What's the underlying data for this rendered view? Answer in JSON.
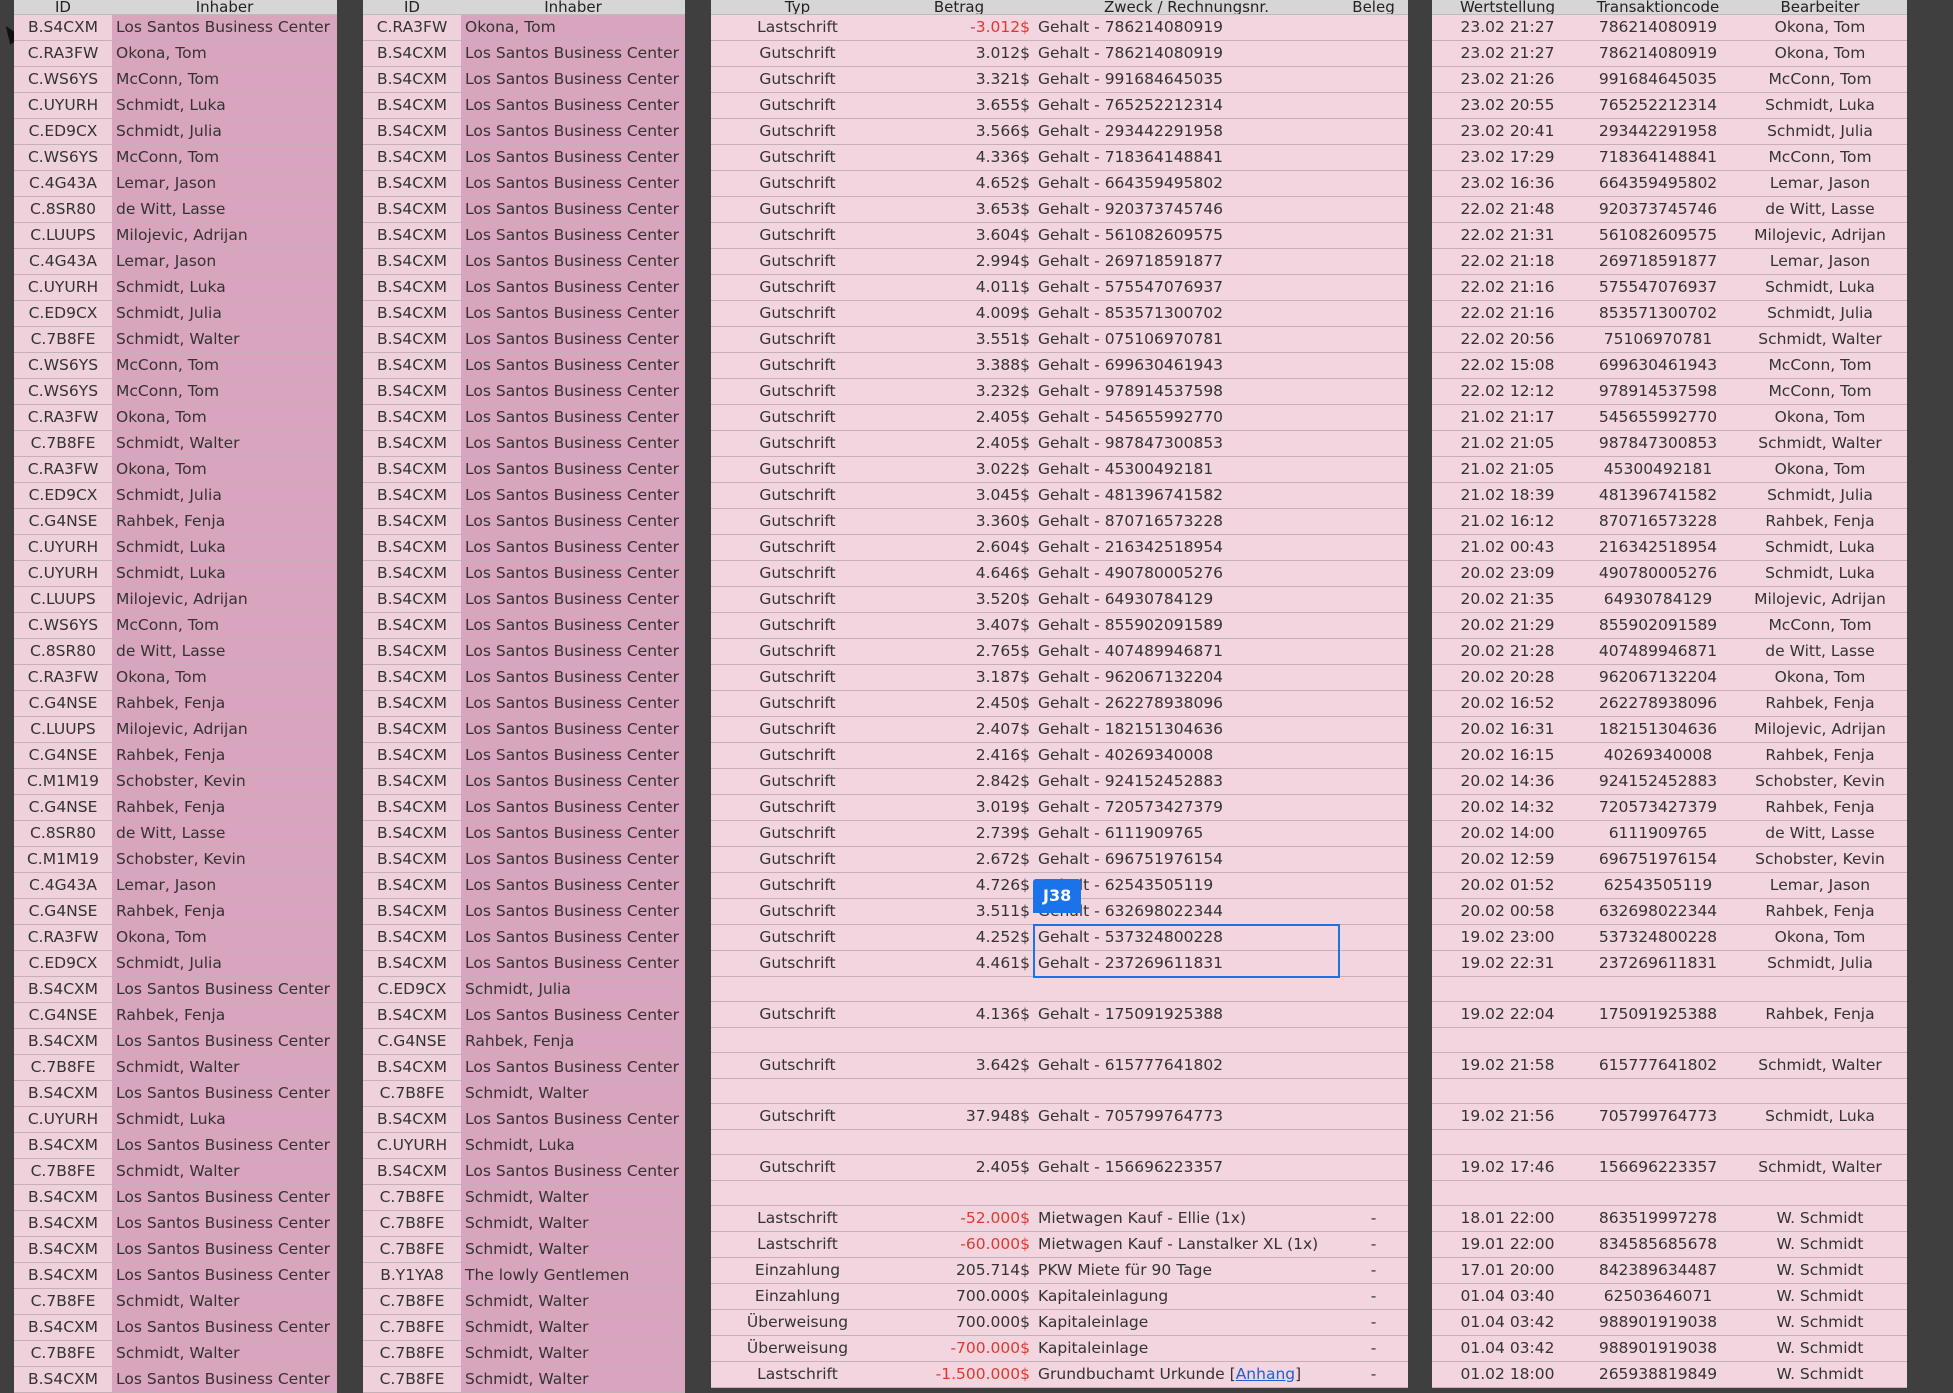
{
  "headers": {
    "left": [
      "ID",
      "Inhaber"
    ],
    "middle": [
      "ID",
      "Inhaber"
    ],
    "ops": [
      "Typ",
      "Betrag",
      "Zweck / Rechnungsnr.",
      "Beleg"
    ],
    "right": [
      "Wertstellung",
      "Transaktioncode",
      "Bearbeiter"
    ]
  },
  "selection": {
    "cell_ref": "J38"
  },
  "rows": [
    [
      "B.S4CXM",
      "Los Santos Business Center",
      "C.RA3FW",
      "Okona, Tom",
      "Lastschrift",
      "-3.012$",
      "Gehalt - 786214080919",
      "",
      "23.02 21:27",
      "786214080919",
      "Okona, Tom"
    ],
    [
      "C.RA3FW",
      "Okona, Tom",
      "B.S4CXM",
      "Los Santos Business Center",
      "Gutschrift",
      "3.012$",
      "Gehalt - 786214080919",
      "",
      "23.02 21:27",
      "786214080919",
      "Okona, Tom"
    ],
    [
      "C.WS6YS",
      "McConn, Tom",
      "B.S4CXM",
      "Los Santos Business Center",
      "Gutschrift",
      "3.321$",
      "Gehalt - 991684645035",
      "",
      "23.02 21:26",
      "991684645035",
      "McConn, Tom"
    ],
    [
      "C.UYURH",
      "Schmidt, Luka",
      "B.S4CXM",
      "Los Santos Business Center",
      "Gutschrift",
      "3.655$",
      "Gehalt - 765252212314",
      "",
      "23.02 20:55",
      "765252212314",
      "Schmidt, Luka"
    ],
    [
      "C.ED9CX",
      "Schmidt, Julia",
      "B.S4CXM",
      "Los Santos Business Center",
      "Gutschrift",
      "3.566$",
      "Gehalt - 293442291958",
      "",
      "23.02 20:41",
      "293442291958",
      "Schmidt, Julia"
    ],
    [
      "C.WS6YS",
      "McConn, Tom",
      "B.S4CXM",
      "Los Santos Business Center",
      "Gutschrift",
      "4.336$",
      "Gehalt - 718364148841",
      "",
      "23.02 17:29",
      "718364148841",
      "McConn, Tom"
    ],
    [
      "C.4G43A",
      "Lemar, Jason",
      "B.S4CXM",
      "Los Santos Business Center",
      "Gutschrift",
      "4.652$",
      "Gehalt - 664359495802",
      "",
      "23.02 16:36",
      "664359495802",
      "Lemar, Jason"
    ],
    [
      "C.8SR80",
      "de Witt, Lasse",
      "B.S4CXM",
      "Los Santos Business Center",
      "Gutschrift",
      "3.653$",
      "Gehalt - 920373745746",
      "",
      "22.02 21:48",
      "920373745746",
      "de Witt, Lasse"
    ],
    [
      "C.LUUPS",
      "Milojevic, Adrijan",
      "B.S4CXM",
      "Los Santos Business Center",
      "Gutschrift",
      "3.604$",
      "Gehalt - 561082609575",
      "",
      "22.02 21:31",
      "561082609575",
      "Milojevic, Adrijan"
    ],
    [
      "C.4G43A",
      "Lemar, Jason",
      "B.S4CXM",
      "Los Santos Business Center",
      "Gutschrift",
      "2.994$",
      "Gehalt - 269718591877",
      "",
      "22.02 21:18",
      "269718591877",
      "Lemar, Jason"
    ],
    [
      "C.UYURH",
      "Schmidt, Luka",
      "B.S4CXM",
      "Los Santos Business Center",
      "Gutschrift",
      "4.011$",
      "Gehalt - 575547076937",
      "",
      "22.02 21:16",
      "575547076937",
      "Schmidt, Luka"
    ],
    [
      "C.ED9CX",
      "Schmidt, Julia",
      "B.S4CXM",
      "Los Santos Business Center",
      "Gutschrift",
      "4.009$",
      "Gehalt - 853571300702",
      "",
      "22.02 21:16",
      "853571300702",
      "Schmidt, Julia"
    ],
    [
      "C.7B8FE",
      "Schmidt, Walter",
      "B.S4CXM",
      "Los Santos Business Center",
      "Gutschrift",
      "3.551$",
      "Gehalt - 075106970781",
      "",
      "22.02 20:56",
      "75106970781",
      "Schmidt, Walter"
    ],
    [
      "C.WS6YS",
      "McConn, Tom",
      "B.S4CXM",
      "Los Santos Business Center",
      "Gutschrift",
      "3.388$",
      "Gehalt - 699630461943",
      "",
      "22.02 15:08",
      "699630461943",
      "McConn, Tom"
    ],
    [
      "C.WS6YS",
      "McConn, Tom",
      "B.S4CXM",
      "Los Santos Business Center",
      "Gutschrift",
      "3.232$",
      "Gehalt - 978914537598",
      "",
      "22.02 12:12",
      "978914537598",
      "McConn, Tom"
    ],
    [
      "C.RA3FW",
      "Okona, Tom",
      "B.S4CXM",
      "Los Santos Business Center",
      "Gutschrift",
      "2.405$",
      "Gehalt - 545655992770",
      "",
      "21.02 21:17",
      "545655992770",
      "Okona, Tom"
    ],
    [
      "C.7B8FE",
      "Schmidt, Walter",
      "B.S4CXM",
      "Los Santos Business Center",
      "Gutschrift",
      "2.405$",
      "Gehalt - 987847300853",
      "",
      "21.02 21:05",
      "987847300853",
      "Schmidt, Walter"
    ],
    [
      "C.RA3FW",
      "Okona, Tom",
      "B.S4CXM",
      "Los Santos Business Center",
      "Gutschrift",
      "3.022$",
      "Gehalt - 45300492181",
      "",
      "21.02 21:05",
      "45300492181",
      "Okona, Tom"
    ],
    [
      "C.ED9CX",
      "Schmidt, Julia",
      "B.S4CXM",
      "Los Santos Business Center",
      "Gutschrift",
      "3.045$",
      "Gehalt - 481396741582",
      "",
      "21.02 18:39",
      "481396741582",
      "Schmidt, Julia"
    ],
    [
      "C.G4NSE",
      "Rahbek, Fenja",
      "B.S4CXM",
      "Los Santos Business Center",
      "Gutschrift",
      "3.360$",
      "Gehalt - 870716573228",
      "",
      "21.02 16:12",
      "870716573228",
      "Rahbek, Fenja"
    ],
    [
      "C.UYURH",
      "Schmidt, Luka",
      "B.S4CXM",
      "Los Santos Business Center",
      "Gutschrift",
      "2.604$",
      "Gehalt - 216342518954",
      "",
      "21.02 00:43",
      "216342518954",
      "Schmidt, Luka"
    ],
    [
      "C.UYURH",
      "Schmidt, Luka",
      "B.S4CXM",
      "Los Santos Business Center",
      "Gutschrift",
      "4.646$",
      "Gehalt - 490780005276",
      "",
      "20.02 23:09",
      "490780005276",
      "Schmidt, Luka"
    ],
    [
      "C.LUUPS",
      "Milojevic, Adrijan",
      "B.S4CXM",
      "Los Santos Business Center",
      "Gutschrift",
      "3.520$",
      "Gehalt - 64930784129",
      "",
      "20.02 21:35",
      "64930784129",
      "Milojevic, Adrijan"
    ],
    [
      "C.WS6YS",
      "McConn, Tom",
      "B.S4CXM",
      "Los Santos Business Center",
      "Gutschrift",
      "3.407$",
      "Gehalt - 855902091589",
      "",
      "20.02 21:29",
      "855902091589",
      "McConn, Tom"
    ],
    [
      "C.8SR80",
      "de Witt, Lasse",
      "B.S4CXM",
      "Los Santos Business Center",
      "Gutschrift",
      "2.765$",
      "Gehalt - 407489946871",
      "",
      "20.02 21:28",
      "407489946871",
      "de Witt, Lasse"
    ],
    [
      "C.RA3FW",
      "Okona, Tom",
      "B.S4CXM",
      "Los Santos Business Center",
      "Gutschrift",
      "3.187$",
      "Gehalt - 962067132204",
      "",
      "20.02 20:28",
      "962067132204",
      "Okona, Tom"
    ],
    [
      "C.G4NSE",
      "Rahbek, Fenja",
      "B.S4CXM",
      "Los Santos Business Center",
      "Gutschrift",
      "2.450$",
      "Gehalt - 262278938096",
      "",
      "20.02 16:52",
      "262278938096",
      "Rahbek, Fenja"
    ],
    [
      "C.LUUPS",
      "Milojevic, Adrijan",
      "B.S4CXM",
      "Los Santos Business Center",
      "Gutschrift",
      "2.407$",
      "Gehalt - 182151304636",
      "",
      "20.02 16:31",
      "182151304636",
      "Milojevic, Adrijan"
    ],
    [
      "C.G4NSE",
      "Rahbek, Fenja",
      "B.S4CXM",
      "Los Santos Business Center",
      "Gutschrift",
      "2.416$",
      "Gehalt - 40269340008",
      "",
      "20.02 16:15",
      "40269340008",
      "Rahbek, Fenja"
    ],
    [
      "C.M1M19",
      "Schobster, Kevin",
      "B.S4CXM",
      "Los Santos Business Center",
      "Gutschrift",
      "2.842$",
      "Gehalt - 924152452883",
      "",
      "20.02 14:36",
      "924152452883",
      "Schobster, Kevin"
    ],
    [
      "C.G4NSE",
      "Rahbek, Fenja",
      "B.S4CXM",
      "Los Santos Business Center",
      "Gutschrift",
      "3.019$",
      "Gehalt - 720573427379",
      "",
      "20.02 14:32",
      "720573427379",
      "Rahbek, Fenja"
    ],
    [
      "C.8SR80",
      "de Witt, Lasse",
      "B.S4CXM",
      "Los Santos Business Center",
      "Gutschrift",
      "2.739$",
      "Gehalt - 6111909765",
      "",
      "20.02 14:00",
      "6111909765",
      "de Witt, Lasse"
    ],
    [
      "C.M1M19",
      "Schobster, Kevin",
      "B.S4CXM",
      "Los Santos Business Center",
      "Gutschrift",
      "2.672$",
      "Gehalt - 696751976154",
      "",
      "20.02 12:59",
      "696751976154",
      "Schobster, Kevin"
    ],
    [
      "C.4G43A",
      "Lemar, Jason",
      "B.S4CXM",
      "Los Santos Business Center",
      "Gutschrift",
      "4.726$",
      "Gehalt - 62543505119",
      "",
      "20.02 01:52",
      "62543505119",
      "Lemar, Jason"
    ],
    [
      "C.G4NSE",
      "Rahbek, Fenja",
      "B.S4CXM",
      "Los Santos Business Center",
      "Gutschrift",
      "3.511$",
      "Gehalt - 632698022344",
      "",
      "20.02 00:58",
      "632698022344",
      "Rahbek, Fenja"
    ],
    [
      "C.RA3FW",
      "Okona, Tom",
      "B.S4CXM",
      "Los Santos Business Center",
      "Gutschrift",
      "4.252$",
      "Gehalt - 537324800228",
      "",
      "19.02 23:00",
      "537324800228",
      "Okona, Tom"
    ],
    [
      "C.ED9CX",
      "Schmidt, Julia",
      "B.S4CXM",
      "Los Santos Business Center",
      "Gutschrift",
      "4.461$",
      "Gehalt - 237269611831",
      "",
      "19.02 22:31",
      "237269611831",
      "Schmidt, Julia"
    ],
    [
      "B.S4CXM",
      "Los Santos Business Center",
      "C.ED9CX",
      "Schmidt, Julia",
      "",
      "",
      "",
      "",
      "",
      "",
      ""
    ],
    [
      "C.G4NSE",
      "Rahbek, Fenja",
      "B.S4CXM",
      "Los Santos Business Center",
      "Gutschrift",
      "4.136$",
      "Gehalt - 175091925388",
      "",
      "19.02 22:04",
      "175091925388",
      "Rahbek, Fenja"
    ],
    [
      "B.S4CXM",
      "Los Santos Business Center",
      "C.G4NSE",
      "Rahbek, Fenja",
      "",
      "",
      "",
      "",
      "",
      "",
      ""
    ],
    [
      "C.7B8FE",
      "Schmidt, Walter",
      "B.S4CXM",
      "Los Santos Business Center",
      "Gutschrift",
      "3.642$",
      "Gehalt - 615777641802",
      "",
      "19.02 21:58",
      "615777641802",
      "Schmidt, Walter"
    ],
    [
      "B.S4CXM",
      "Los Santos Business Center",
      "C.7B8FE",
      "Schmidt, Walter",
      "",
      "",
      "",
      "",
      "",
      "",
      ""
    ],
    [
      "C.UYURH",
      "Schmidt, Luka",
      "B.S4CXM",
      "Los Santos Business Center",
      "Gutschrift",
      "37.948$",
      "Gehalt - 705799764773",
      "",
      "19.02 21:56",
      "705799764773",
      "Schmidt, Luka"
    ],
    [
      "B.S4CXM",
      "Los Santos Business Center",
      "C.UYURH",
      "Schmidt, Luka",
      "",
      "",
      "",
      "",
      "",
      "",
      ""
    ],
    [
      "C.7B8FE",
      "Schmidt, Walter",
      "B.S4CXM",
      "Los Santos Business Center",
      "Gutschrift",
      "2.405$",
      "Gehalt - 156696223357",
      "",
      "19.02 17:46",
      "156696223357",
      "Schmidt, Walter"
    ],
    [
      "B.S4CXM",
      "Los Santos Business Center",
      "C.7B8FE",
      "Schmidt, Walter",
      "",
      "",
      "",
      "",
      "",
      "",
      ""
    ],
    [
      "B.S4CXM",
      "Los Santos Business Center",
      "C.7B8FE",
      "Schmidt, Walter",
      "Lastschrift",
      "-52.000$",
      "Mietwagen Kauf - Ellie (1x)",
      "-",
      "18.01 22:00",
      "863519997278",
      "W. Schmidt"
    ],
    [
      "B.S4CXM",
      "Los Santos Business Center",
      "C.7B8FE",
      "Schmidt, Walter",
      "Lastschrift",
      "-60.000$",
      "Mietwagen Kauf - Lanstalker XL (1x)",
      "-",
      "19.01 22:00",
      "834585685678",
      "W. Schmidt"
    ],
    [
      "B.S4CXM",
      "Los Santos Business Center",
      "B.Y1YA8",
      "The lowly Gentlemen",
      "Einzahlung",
      "205.714$",
      "PKW Miete für 90 Tage",
      "-",
      "17.01 20:00",
      "842389634487",
      "W. Schmidt"
    ],
    [
      "C.7B8FE",
      "Schmidt, Walter",
      "C.7B8FE",
      "Schmidt, Walter",
      "Einzahlung",
      "700.000$",
      "Kapitaleinlagung",
      "-",
      "01.04 03:40",
      "62503646071",
      "W. Schmidt"
    ],
    [
      "B.S4CXM",
      "Los Santos Business Center",
      "C.7B8FE",
      "Schmidt, Walter",
      "Überweisung",
      "700.000$",
      "Kapitaleinlage",
      "-",
      "01.04 03:42",
      "988901919038",
      "W. Schmidt"
    ],
    [
      "C.7B8FE",
      "Schmidt, Walter",
      "C.7B8FE",
      "Schmidt, Walter",
      "Überweisung",
      "-700.000$",
      "Kapitaleinlage",
      "-",
      "01.04 03:42",
      "988901919038",
      "W. Schmidt"
    ],
    [
      "B.S4CXM",
      "Los Santos Business Center",
      "C.7B8FE",
      "Schmidt, Walter",
      "Lastschrift",
      "-1.500.000$",
      "Grundbuchamt Urkunde [",
      "-",
      "01.02 18:00",
      "265938819849",
      "W. Schmidt"
    ]
  ],
  "last_row_link": {
    "text": "Anhang",
    "suffix": "]"
  },
  "colors": {
    "background": "#3f3f3f",
    "id_cell": "#efd1db",
    "owner_cell": "#d9a5be",
    "ops_cell": "#f2d5df",
    "negative": "#e0392f",
    "selection": "#1a73e8"
  }
}
